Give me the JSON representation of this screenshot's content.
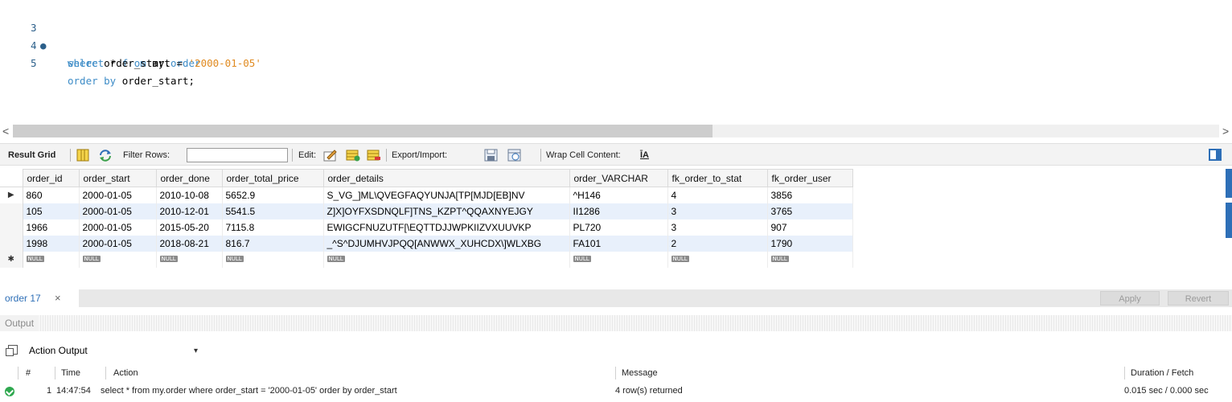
{
  "editor": {
    "lines": [
      {
        "number": "3",
        "marker": "●",
        "keyword1": "select",
        "text1": " * ",
        "keyword2": "from",
        "text2": " my.",
        "keyword3": "order"
      },
      {
        "number": "4",
        "keyword": "where",
        "text": " order_start = ",
        "string": "'2000-01-05'"
      },
      {
        "number": "5",
        "keyword": "order by",
        "text": " order_start;"
      }
    ]
  },
  "scrollbar": {
    "left_arrow": "<",
    "right_arrow": ">"
  },
  "toolbar": {
    "result_grid_label": "Result Grid",
    "filter_label": "Filter Rows:",
    "filter_value": "",
    "edit_label": "Edit:",
    "export_label": "Export/Import:",
    "wrap_label": "Wrap Cell Content:",
    "wrap_icon_text": "ĪA"
  },
  "grid": {
    "columns": [
      "order_id",
      "order_start",
      "order_done",
      "order_total_price",
      "order_details",
      "order_VARCHAR",
      "fk_order_to_stat",
      "fk_order_user"
    ],
    "rows": [
      [
        "860",
        "2000-01-05",
        "2010-10-08",
        "5652.9",
        "S_VG_]ML\\QVEGFAQYUNJA[TP[MJD[EB]NV",
        "^H146",
        "4",
        "3856"
      ],
      [
        "105",
        "2000-01-05",
        "2010-12-01",
        "5541.5",
        "Z]X]OYFXSDNQLF]TNS_KZPT^QQAXNYEJGY",
        "II1286",
        "3",
        "3765"
      ],
      [
        "1966",
        "2000-01-05",
        "2015-05-20",
        "7115.8",
        "EWIGCFNUZUTF[\\EQTTDJJWPKIIZVXUUVKP",
        "PL720",
        "3",
        "907"
      ],
      [
        "1998",
        "2000-01-05",
        "2018-08-21",
        "816.7",
        "_^S^DJUMHVJPQQ[ANWWX_XUHCDX\\]WLXBG",
        "FA101",
        "2",
        "1790"
      ]
    ],
    "current_row_marker": "▶",
    "new_row_marker": "✱",
    "null_label": "NULL"
  },
  "tabs": {
    "active_tab": "order 17",
    "close_symbol": "×",
    "apply_label": "Apply",
    "revert_label": "Revert"
  },
  "output": {
    "title": "Output",
    "select_value": "Action Output",
    "caret": "▾",
    "columns": {
      "num": "#",
      "time": "Time",
      "action": "Action",
      "message": "Message",
      "duration": "Duration / Fetch"
    },
    "rows": [
      {
        "num": "1",
        "time": "14:47:54",
        "action": "select * from my.order  where order_start = '2000-01-05' order by order_start",
        "message": "4 row(s) returned",
        "duration": "0.015 sec / 0.000 sec"
      }
    ]
  },
  "colors": {
    "accent": "#2e6fb7",
    "keyword": "#3d8cc7",
    "string": "#e08a20",
    "success": "#2fa84f"
  }
}
